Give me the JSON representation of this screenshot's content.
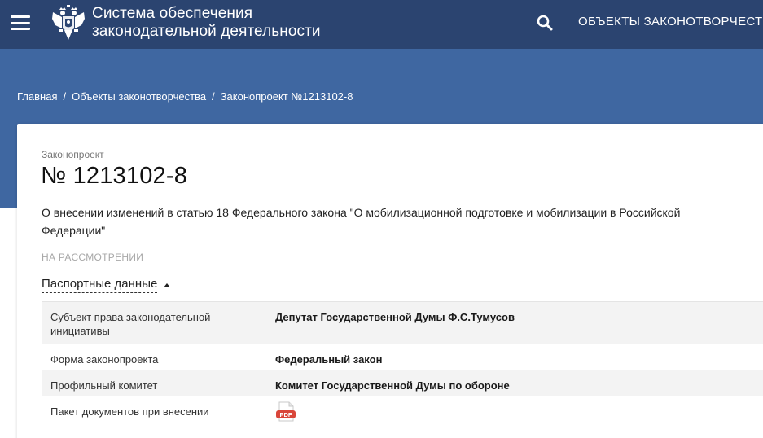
{
  "header": {
    "site_title_line1": "Система обеспечения",
    "site_title_line2": "законодательной деятельности",
    "nav_link": "ОБЪЕКТЫ ЗАКОНОТВОРЧЕСТВА",
    "menu_icon": "hamburger-menu-icon",
    "search_icon": "search-icon",
    "emblem_icon": "coat-of-arms-emblem",
    "bg_color": "#2b4470"
  },
  "breadcrumb": {
    "items": [
      "Главная",
      "Объекты законотворчества",
      "Законопроект №1213102-8"
    ],
    "separator": "/"
  },
  "bill": {
    "type_label": "Законопроект",
    "number": "№ 1213102-8",
    "title": "О внесении изменений в статью 18 Федерального закона \"О мобилизационной подготовке и мобилизации в Российской Федерации\"",
    "status": "НА РАССМОТРЕНИИ"
  },
  "passport": {
    "toggle_label": "Паспортные данные",
    "rows": [
      {
        "key": "Субъект права законодательной инициативы",
        "value": "Депутат Государственной Думы Ф.С.Тумусов"
      },
      {
        "key": "Форма законопроекта",
        "value": "Федеральный закон"
      },
      {
        "key": "Профильный комитет",
        "value": "Комитет Государственной Думы по обороне"
      },
      {
        "key": "Пакет документов при внесении",
        "value": "PDF"
      }
    ]
  },
  "colors": {
    "hero": "#3f67a1",
    "pdf_red": "#d9463a"
  }
}
